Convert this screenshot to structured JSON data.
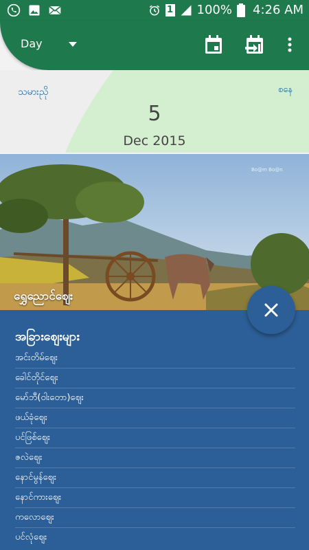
{
  "status_bar": {
    "battery_text": "100%",
    "time": "4:26 AM",
    "sim_label": "1",
    "left_icons": [
      "phone-icon",
      "image-icon",
      "mail-icon"
    ]
  },
  "toolbar": {
    "view_mode": "Day",
    "actions": [
      "calendar-icon",
      "go-to-date-icon",
      "more-vert-icon"
    ]
  },
  "date_header": {
    "left_label": "သမားညို",
    "right_label": "စနေ",
    "day": "5",
    "month_year": "Dec 2015"
  },
  "photo": {
    "caption": "ရွှေညောင်ဈေး",
    "watermark": "Bo@m Bo@n"
  },
  "markets": {
    "title": "အခြားဈေးများ",
    "items": [
      "အင်းတိမ်ဈေး",
      "ခေါင်တိုင်ဈေး",
      "မော်ဘီ(ဝါးတော)ဈေး",
      "ဖယ်ခုံဈေး",
      "ပင်ဖြစ်ဈေး",
      "ဇလဲဈေး",
      "နောင်မွန်ဈေး",
      "နောင်ကားဈေး",
      "ကလောဈေး",
      "ပင်လုံဈေး"
    ]
  },
  "colors": {
    "primary_green": "#1e7a4c",
    "light_green": "#d4efcf",
    "panel_blue": "#2c5f97",
    "label_blue": "#1565a8"
  }
}
